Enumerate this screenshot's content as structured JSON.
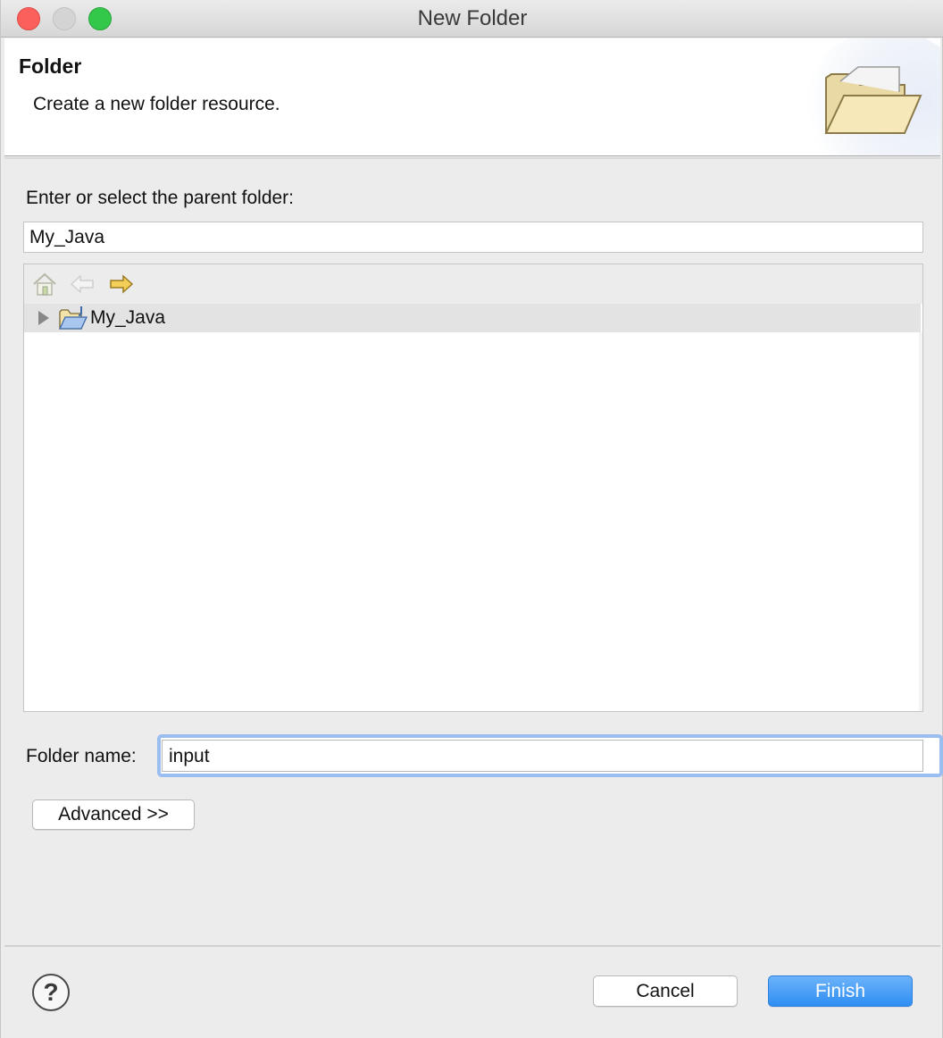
{
  "window": {
    "title": "New Folder"
  },
  "banner": {
    "title": "Folder",
    "description": "Create a new folder resource.",
    "icon": "open-folder-icon"
  },
  "parent_folder": {
    "label": "Enter or select the parent folder:",
    "value": "My_Java"
  },
  "tree": {
    "toolbar": {
      "icons": [
        "home-icon",
        "back-arrow-icon",
        "forward-arrow-icon"
      ]
    },
    "items": [
      {
        "label": "My_Java",
        "icon": "java-project-folder-icon",
        "expanded": false,
        "selected": true
      }
    ]
  },
  "folder_name": {
    "label": "Folder name:",
    "value": "input"
  },
  "buttons": {
    "advanced": "Advanced >>",
    "cancel": "Cancel",
    "finish": "Finish",
    "help": "?"
  },
  "colors": {
    "finish_button": "#3b93f3",
    "focus_ring": "#9bbef0",
    "close": "#fc605c",
    "maximize": "#34c84a"
  }
}
